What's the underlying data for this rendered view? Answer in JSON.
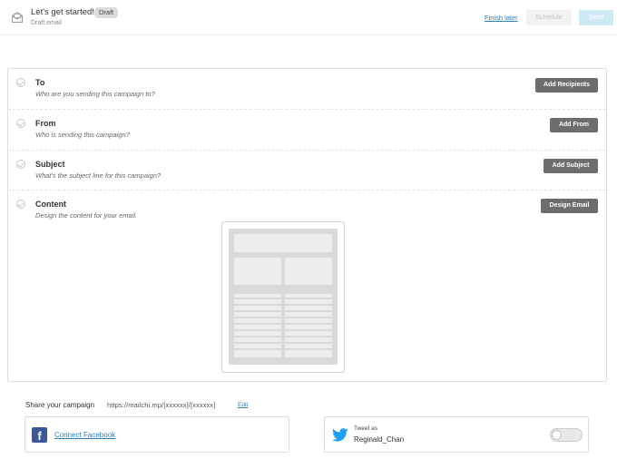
{
  "header": {
    "title": "Let's get started!",
    "status_badge": "Draft",
    "subtitle": "Draft email",
    "finish_later": "Finish later",
    "schedule": "Schedule",
    "send": "Send"
  },
  "checklist": [
    {
      "title": "To",
      "description": "Who are you sending this campaign to?",
      "button": "Add Recipients"
    },
    {
      "title": "From",
      "description": "Who is sending this campaign?",
      "button": "Add From"
    },
    {
      "title": "Subject",
      "description": "What's the subject line for this campaign?",
      "button": "Add Subject"
    },
    {
      "title": "Content",
      "description": "Design the content for your email.",
      "button": "Design Email"
    }
  ],
  "share": {
    "label": "Share your campaign",
    "url": "https://mailchi.mp/[xxxxxx]/[xxxxxx]",
    "edit": "Edit",
    "facebook": {
      "link": "Connect Facebook",
      "icon": "facebook-icon"
    },
    "twitter": {
      "label": "Tweet as",
      "handle": "Reginald_Chan",
      "icon": "twitter-icon",
      "enabled": false
    }
  },
  "colors": {
    "accent_link": "#2d7fb8",
    "action_button": "#6d6d6d",
    "send_disabled": "#cde9f3",
    "facebook": "#3b5998",
    "twitter": "#1da1f2"
  }
}
